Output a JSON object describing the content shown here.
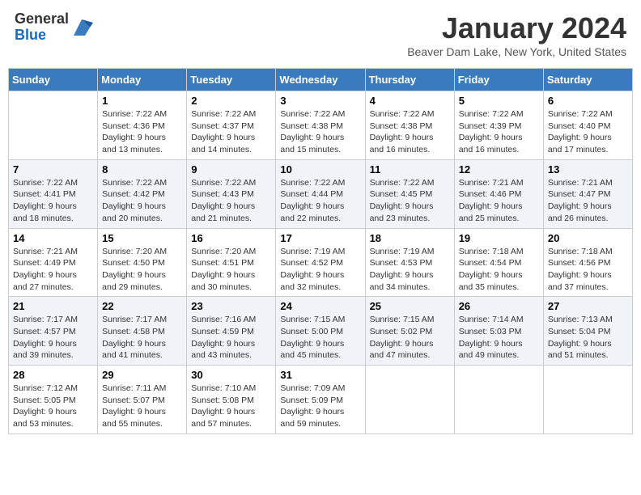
{
  "header": {
    "logo": {
      "line1": "General",
      "line2": "Blue"
    },
    "title": "January 2024",
    "location": "Beaver Dam Lake, New York, United States"
  },
  "days_of_week": [
    "Sunday",
    "Monday",
    "Tuesday",
    "Wednesday",
    "Thursday",
    "Friday",
    "Saturday"
  ],
  "weeks": [
    [
      {
        "day": "",
        "info": ""
      },
      {
        "day": "1",
        "info": "Sunrise: 7:22 AM\nSunset: 4:36 PM\nDaylight: 9 hours\nand 13 minutes."
      },
      {
        "day": "2",
        "info": "Sunrise: 7:22 AM\nSunset: 4:37 PM\nDaylight: 9 hours\nand 14 minutes."
      },
      {
        "day": "3",
        "info": "Sunrise: 7:22 AM\nSunset: 4:38 PM\nDaylight: 9 hours\nand 15 minutes."
      },
      {
        "day": "4",
        "info": "Sunrise: 7:22 AM\nSunset: 4:38 PM\nDaylight: 9 hours\nand 16 minutes."
      },
      {
        "day": "5",
        "info": "Sunrise: 7:22 AM\nSunset: 4:39 PM\nDaylight: 9 hours\nand 16 minutes."
      },
      {
        "day": "6",
        "info": "Sunrise: 7:22 AM\nSunset: 4:40 PM\nDaylight: 9 hours\nand 17 minutes."
      }
    ],
    [
      {
        "day": "7",
        "info": "Sunrise: 7:22 AM\nSunset: 4:41 PM\nDaylight: 9 hours\nand 18 minutes."
      },
      {
        "day": "8",
        "info": "Sunrise: 7:22 AM\nSunset: 4:42 PM\nDaylight: 9 hours\nand 20 minutes."
      },
      {
        "day": "9",
        "info": "Sunrise: 7:22 AM\nSunset: 4:43 PM\nDaylight: 9 hours\nand 21 minutes."
      },
      {
        "day": "10",
        "info": "Sunrise: 7:22 AM\nSunset: 4:44 PM\nDaylight: 9 hours\nand 22 minutes."
      },
      {
        "day": "11",
        "info": "Sunrise: 7:22 AM\nSunset: 4:45 PM\nDaylight: 9 hours\nand 23 minutes."
      },
      {
        "day": "12",
        "info": "Sunrise: 7:21 AM\nSunset: 4:46 PM\nDaylight: 9 hours\nand 25 minutes."
      },
      {
        "day": "13",
        "info": "Sunrise: 7:21 AM\nSunset: 4:47 PM\nDaylight: 9 hours\nand 26 minutes."
      }
    ],
    [
      {
        "day": "14",
        "info": "Sunrise: 7:21 AM\nSunset: 4:49 PM\nDaylight: 9 hours\nand 27 minutes."
      },
      {
        "day": "15",
        "info": "Sunrise: 7:20 AM\nSunset: 4:50 PM\nDaylight: 9 hours\nand 29 minutes."
      },
      {
        "day": "16",
        "info": "Sunrise: 7:20 AM\nSunset: 4:51 PM\nDaylight: 9 hours\nand 30 minutes."
      },
      {
        "day": "17",
        "info": "Sunrise: 7:19 AM\nSunset: 4:52 PM\nDaylight: 9 hours\nand 32 minutes."
      },
      {
        "day": "18",
        "info": "Sunrise: 7:19 AM\nSunset: 4:53 PM\nDaylight: 9 hours\nand 34 minutes."
      },
      {
        "day": "19",
        "info": "Sunrise: 7:18 AM\nSunset: 4:54 PM\nDaylight: 9 hours\nand 35 minutes."
      },
      {
        "day": "20",
        "info": "Sunrise: 7:18 AM\nSunset: 4:56 PM\nDaylight: 9 hours\nand 37 minutes."
      }
    ],
    [
      {
        "day": "21",
        "info": "Sunrise: 7:17 AM\nSunset: 4:57 PM\nDaylight: 9 hours\nand 39 minutes."
      },
      {
        "day": "22",
        "info": "Sunrise: 7:17 AM\nSunset: 4:58 PM\nDaylight: 9 hours\nand 41 minutes."
      },
      {
        "day": "23",
        "info": "Sunrise: 7:16 AM\nSunset: 4:59 PM\nDaylight: 9 hours\nand 43 minutes."
      },
      {
        "day": "24",
        "info": "Sunrise: 7:15 AM\nSunset: 5:00 PM\nDaylight: 9 hours\nand 45 minutes."
      },
      {
        "day": "25",
        "info": "Sunrise: 7:15 AM\nSunset: 5:02 PM\nDaylight: 9 hours\nand 47 minutes."
      },
      {
        "day": "26",
        "info": "Sunrise: 7:14 AM\nSunset: 5:03 PM\nDaylight: 9 hours\nand 49 minutes."
      },
      {
        "day": "27",
        "info": "Sunrise: 7:13 AM\nSunset: 5:04 PM\nDaylight: 9 hours\nand 51 minutes."
      }
    ],
    [
      {
        "day": "28",
        "info": "Sunrise: 7:12 AM\nSunset: 5:05 PM\nDaylight: 9 hours\nand 53 minutes."
      },
      {
        "day": "29",
        "info": "Sunrise: 7:11 AM\nSunset: 5:07 PM\nDaylight: 9 hours\nand 55 minutes."
      },
      {
        "day": "30",
        "info": "Sunrise: 7:10 AM\nSunset: 5:08 PM\nDaylight: 9 hours\nand 57 minutes."
      },
      {
        "day": "31",
        "info": "Sunrise: 7:09 AM\nSunset: 5:09 PM\nDaylight: 9 hours\nand 59 minutes."
      },
      {
        "day": "",
        "info": ""
      },
      {
        "day": "",
        "info": ""
      },
      {
        "day": "",
        "info": ""
      }
    ]
  ]
}
